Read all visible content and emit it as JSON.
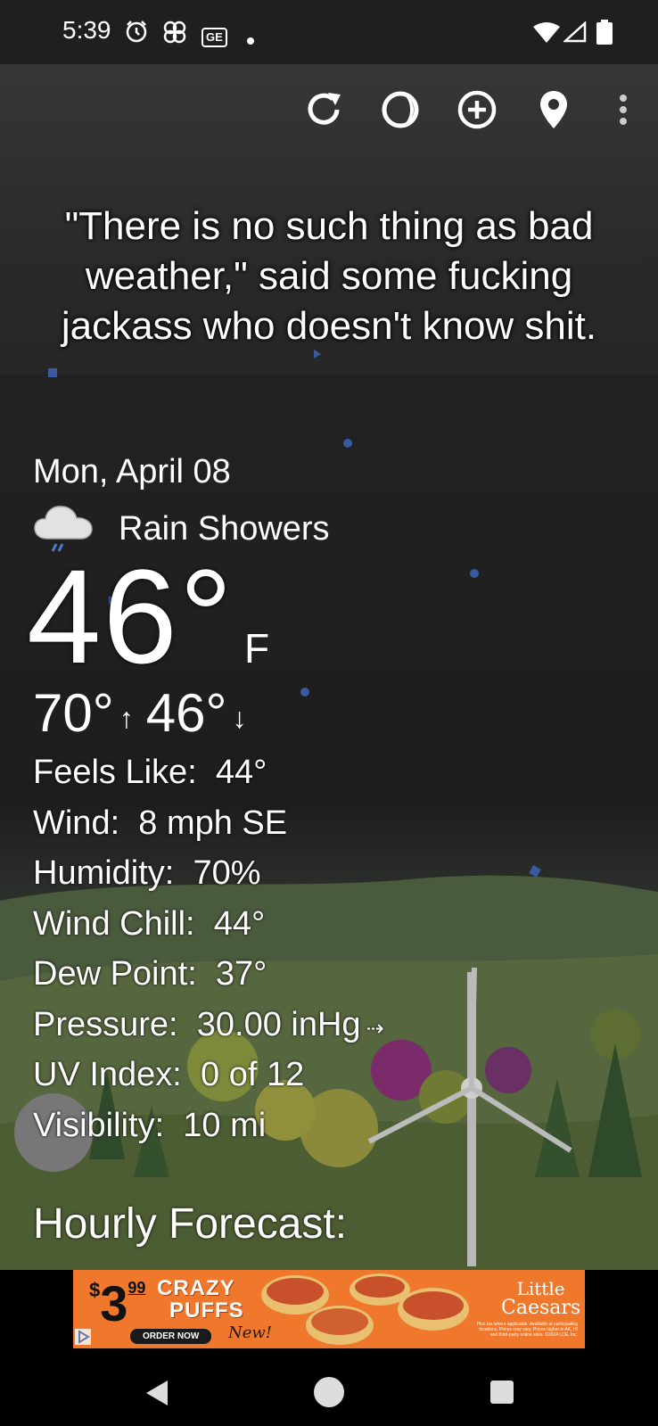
{
  "status_bar": {
    "time": "5:39",
    "icons": [
      "alarm-icon",
      "pinwheel-icon",
      "ge-icon",
      "dot-icon",
      "wifi-icon",
      "signal-icon",
      "battery-icon"
    ],
    "ge_label": "GE"
  },
  "toolbar": {
    "icons": [
      "refresh-icon",
      "moon-phase-icon",
      "add-location-icon",
      "location-pin-icon",
      "more-vert-icon"
    ]
  },
  "quote": "\"There is no such thing as bad weather,\" said some fucking jackass who doesn't know shit.",
  "weather": {
    "date": "Mon, April 08",
    "condition": "Rain Showers",
    "condition_icon": "rain-cloud-icon",
    "temperature": "46°",
    "unit": "F",
    "high": "70°",
    "low": "46°",
    "details": [
      {
        "label": "Feels Like:",
        "value": "44°"
      },
      {
        "label": "Wind:",
        "value": "8 mph SE"
      },
      {
        "label": "Humidity:",
        "value": "70%"
      },
      {
        "label": "Wind Chill:",
        "value": "44°"
      },
      {
        "label": "Dew Point:",
        "value": "37°"
      },
      {
        "label": "Pressure:",
        "value": "30.00 inHg"
      },
      {
        "label": "UV Index:",
        "value": "0 of 12"
      },
      {
        "label": "Visibility:",
        "value": "10 mi"
      }
    ],
    "hourly_title": "Hourly Forecast:"
  },
  "ad": {
    "price_dollar": "$",
    "price_main": "3",
    "price_cents": "99",
    "headline_1": "CRAZY",
    "headline_2": "PUFFS",
    "cta": "ORDER NOW",
    "tag": "New!",
    "brand_1": "Little",
    "brand_2": "Caesars",
    "fine_print": "Plus tax where applicable. Available at participating locations. Prices may vary. Prices higher in AK, HI and third-party online sites. ©2024 LCE, Inc."
  },
  "colors": {
    "ad_background": "#f0782c",
    "text": "#ffffff"
  }
}
